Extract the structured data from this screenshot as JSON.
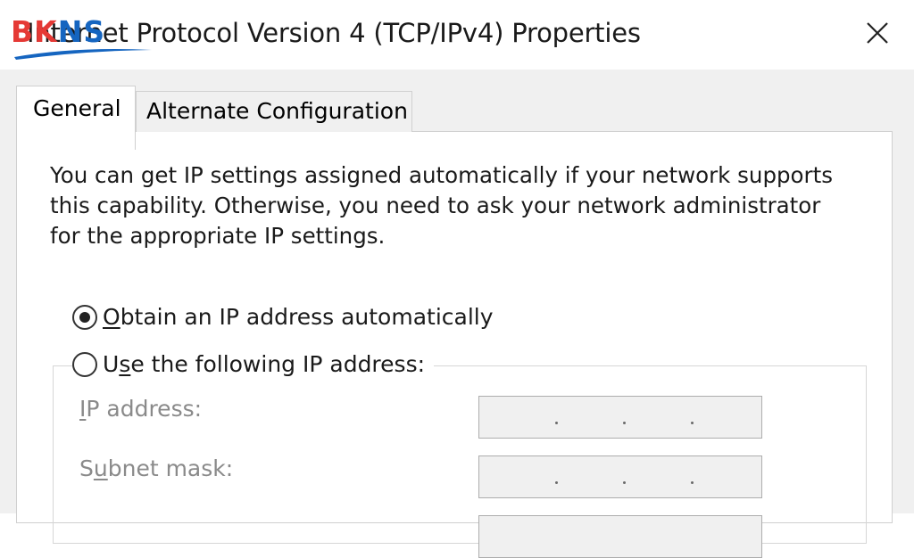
{
  "window": {
    "title": "Internet Protocol Version 4 (TCP/IPv4) Properties",
    "close_icon": "close-icon"
  },
  "watermark": {
    "brand": "BKNS",
    "colors": {
      "b_k": "#e53935",
      "n_s": "#1565c0"
    }
  },
  "tabs": [
    {
      "label": "General",
      "selected": true
    },
    {
      "label": "Alternate Configuration",
      "selected": false
    }
  ],
  "general": {
    "intro_text": "You can get IP settings assigned automatically if your network supports this capability. Otherwise, you need to ask your network administrator for the appropriate IP settings.",
    "radio_auto": {
      "label_mnemonic": "O",
      "label_rest": "btain an IP address automatically",
      "checked": true
    },
    "radio_manual": {
      "label_pre": "U",
      "label_mnemonic": "s",
      "label_rest": "e the following IP address:",
      "checked": false
    },
    "fields": [
      {
        "label_mnemonic": "I",
        "label_rest": "P address:",
        "value": ""
      },
      {
        "label_pre": "S",
        "label_mnemonic": "u",
        "label_rest": "bnet mask:",
        "value": ""
      }
    ]
  },
  "colors": {
    "dialog_bg": "#f0f0f0",
    "panel_bg": "#ffffff",
    "disabled_text": "#8a8a8a"
  }
}
